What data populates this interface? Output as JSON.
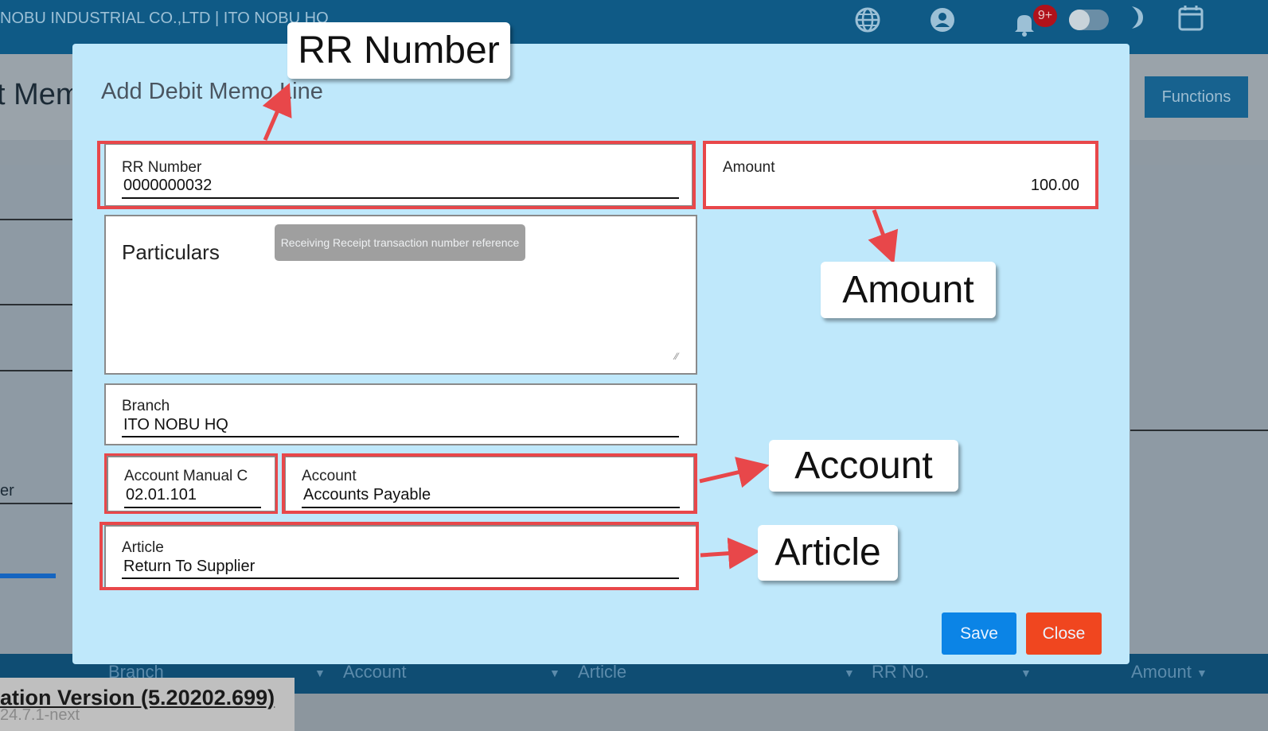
{
  "topbar": {
    "company": "NOBU INDUSTRIAL CO.,LTD | ITO NOBU HQ",
    "icons": [
      "globe-icon",
      "user-icon",
      "bell-icon",
      "toggle",
      "moon-icon",
      "calendar-icon"
    ],
    "notification_count": "9+"
  },
  "page": {
    "title": "t Mem",
    "functions_label": "Functions",
    "side_label": "er"
  },
  "modal": {
    "title": "Add Debit Memo Line",
    "rr_number": {
      "label": "RR Number",
      "value": "0000000032"
    },
    "amount": {
      "label": "Amount",
      "value": "100.00"
    },
    "particulars": {
      "label": "Particulars",
      "value": ""
    },
    "tooltip": "Receiving Receipt transaction number reference",
    "branch": {
      "label": "Branch",
      "value": "ITO NOBU HQ"
    },
    "account_manual_code": {
      "label": "Account Manual C",
      "value": "02.01.101"
    },
    "account": {
      "label": "Account",
      "value": "Accounts Payable"
    },
    "article": {
      "label": "Article",
      "value": "Return To Supplier"
    },
    "save_label": "Save",
    "close_label": "Close"
  },
  "grid": {
    "columns": [
      "Branch",
      "Account",
      "Article",
      "RR No.",
      "Amount"
    ]
  },
  "footer": {
    "version": "ation Version (5.20202.699)",
    "build": "24.7.1-next"
  },
  "callouts": {
    "rr_number": "RR Number",
    "amount": "Amount",
    "account": "Account",
    "article": "Article"
  },
  "colors": {
    "highlight": "#e8474a",
    "modal_bg": "#bfe8fb",
    "save": "#0b84e6",
    "close": "#f0461f"
  }
}
